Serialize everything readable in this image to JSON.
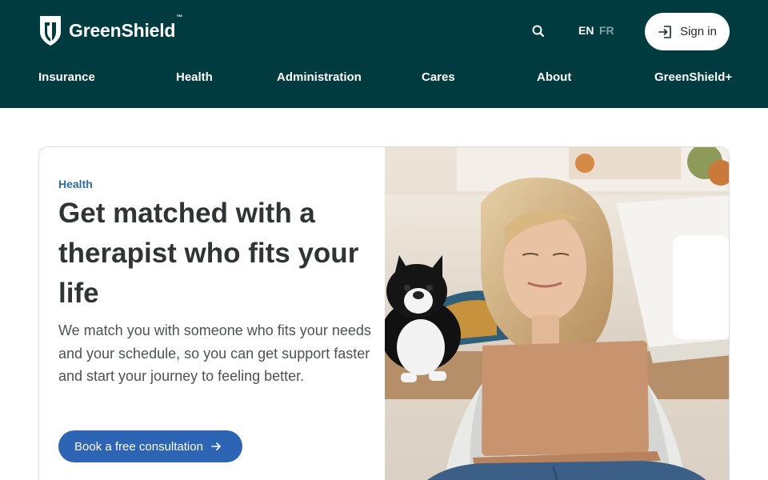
{
  "header": {
    "brand": "GreenShield",
    "brand_tm": "™",
    "search_icon": "search-icon",
    "languages": {
      "en": "EN",
      "fr": "FR"
    },
    "sign_in_label": "Sign in",
    "sign_in_icon": "sign-in-icon"
  },
  "nav": {
    "items": [
      {
        "label": "Insurance"
      },
      {
        "label": "Health"
      },
      {
        "label": "Administration"
      },
      {
        "label": "Cares"
      },
      {
        "label": "About"
      },
      {
        "label": "GreenShield+"
      }
    ]
  },
  "hero": {
    "eyebrow": "Health",
    "title": "Get matched with a therapist who fits your life",
    "description": "We match you with someone who fits your needs and your schedule, so you can get support faster and start your journey to feeling better.",
    "cta_label": "Book a free consultation",
    "cta_icon": "arrow-right-icon",
    "image_subject": "woman on sofa with laptop and dog"
  },
  "colors": {
    "header_bg": "#003b3f",
    "accent": "#2d64b3",
    "eyebrow": "#2f6ea0",
    "lang_inactive": "#7fa3a5"
  }
}
